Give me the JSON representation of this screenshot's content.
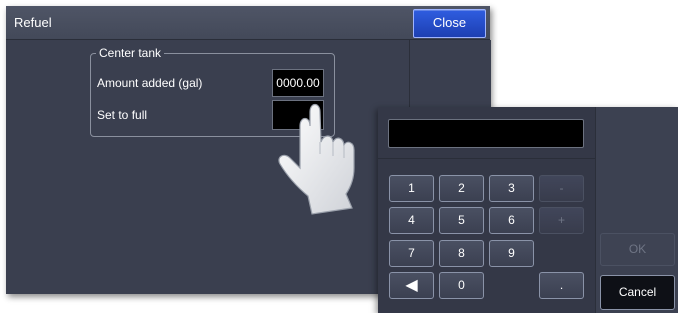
{
  "dialog": {
    "title": "Refuel",
    "close_label": "Close",
    "group": {
      "legend": "Center tank",
      "amount_label": "Amount added (gal)",
      "amount_value": "0000.00",
      "full_label": "Set to full",
      "full_value": ""
    }
  },
  "keypad": {
    "display_value": "",
    "keys": [
      {
        "label": "1",
        "enabled": true
      },
      {
        "label": "2",
        "enabled": true
      },
      {
        "label": "3",
        "enabled": true
      },
      {
        "label": "-",
        "enabled": false
      },
      {
        "label": "4",
        "enabled": true
      },
      {
        "label": "5",
        "enabled": true
      },
      {
        "label": "6",
        "enabled": true
      },
      {
        "label": "+",
        "enabled": false
      },
      {
        "label": "7",
        "enabled": true
      },
      {
        "label": "8",
        "enabled": true
      },
      {
        "label": "9",
        "enabled": true
      },
      {
        "label": "◀",
        "enabled": true
      },
      {
        "label": "0",
        "enabled": true
      },
      {
        "label": ".",
        "enabled": true
      }
    ],
    "ok_label": "OK",
    "cancel_label": "Cancel"
  },
  "icons": {
    "pointer": "hand-pointer-icon"
  },
  "colors": {
    "accent": "#2450d0",
    "panel": "#3a3f4f",
    "field": "#000000"
  }
}
